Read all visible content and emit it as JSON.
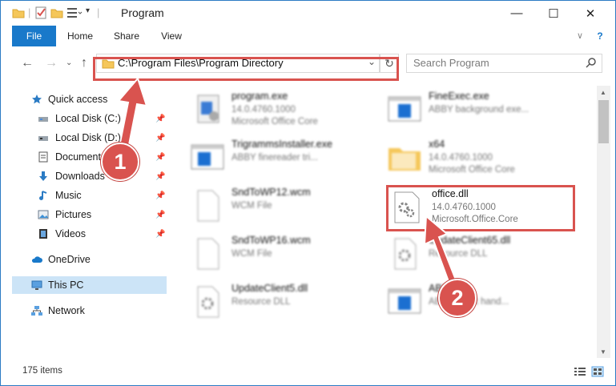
{
  "window": {
    "title": "Program",
    "controls": {
      "minimize": "—",
      "maximize": "☐",
      "close": "✕"
    }
  },
  "ribbon": {
    "tabs": [
      "File",
      "Home",
      "Share",
      "View"
    ],
    "help": "?"
  },
  "nav": {
    "address": "C:\\Program Files\\Program Directory",
    "search_placeholder": "Search Program"
  },
  "sidebar": {
    "items": [
      {
        "label": "Quick access",
        "icon": "star-icon",
        "pinned": false
      },
      {
        "label": "Local Disk (C:)",
        "icon": "drive-icon",
        "pinned": true
      },
      {
        "label": "Local Disk (D:)",
        "icon": "drive-icon",
        "pinned": true
      },
      {
        "label": "Documents",
        "icon": "documents-icon",
        "pinned": true
      },
      {
        "label": "Downloads",
        "icon": "download-icon",
        "pinned": true
      },
      {
        "label": "Music",
        "icon": "music-icon",
        "pinned": true
      },
      {
        "label": "Pictures",
        "icon": "pictures-icon",
        "pinned": true
      },
      {
        "label": "Videos",
        "icon": "videos-icon",
        "pinned": true
      },
      {
        "label": "OneDrive",
        "icon": "cloud-icon",
        "pinned": false
      },
      {
        "label": "This PC",
        "icon": "computer-icon",
        "pinned": false,
        "selected": true
      },
      {
        "label": "Network",
        "icon": "network-icon",
        "pinned": false
      }
    ]
  },
  "files": [
    {
      "name": "program.exe",
      "l2": "14.0.4760.1000",
      "l3": "Microsoft Office Core",
      "icon": "exe-icon"
    },
    {
      "name": "FineExec.exe",
      "l2": "ABBY background exe...",
      "l3": "",
      "icon": "app-window-icon"
    },
    {
      "name": "TrigrammsInstaller.exe",
      "l2": "ABBY finereader tri...",
      "l3": "",
      "icon": "app-window-icon"
    },
    {
      "name": "x64",
      "l2": "14.0.4760.1000",
      "l3": "Microsoft Office Core",
      "icon": "folder-icon"
    },
    {
      "name": "SndToWP12.wcm",
      "l2": "WCM File",
      "l3": "",
      "icon": "file-icon"
    },
    {
      "name": "office.dll",
      "l2": "14.0.4760.1000",
      "l3": "Microsoft.Office.Core",
      "icon": "dll-gear-icon"
    },
    {
      "name": "SndToWP16.wcm",
      "l2": "WCM File",
      "l3": "",
      "icon": "file-icon"
    },
    {
      "name": "UpdateClient65.dll",
      "l2": "Resource DLL",
      "l3": "",
      "icon": "dll-gear-icon"
    },
    {
      "name": "UpdateClient5.dll",
      "l2": "Resource DLL",
      "l3": "",
      "icon": "dll-gear-icon"
    },
    {
      "name": "ABBY.exe",
      "l2": "ABBY event hand...",
      "l3": "",
      "icon": "app-window-icon"
    }
  ],
  "status": {
    "count": "175 items"
  },
  "callouts": {
    "step1": "1",
    "step2": "2"
  },
  "colors": {
    "accent": "#1979ca",
    "highlight": "#d9534f",
    "selected": "#cce4f7"
  }
}
